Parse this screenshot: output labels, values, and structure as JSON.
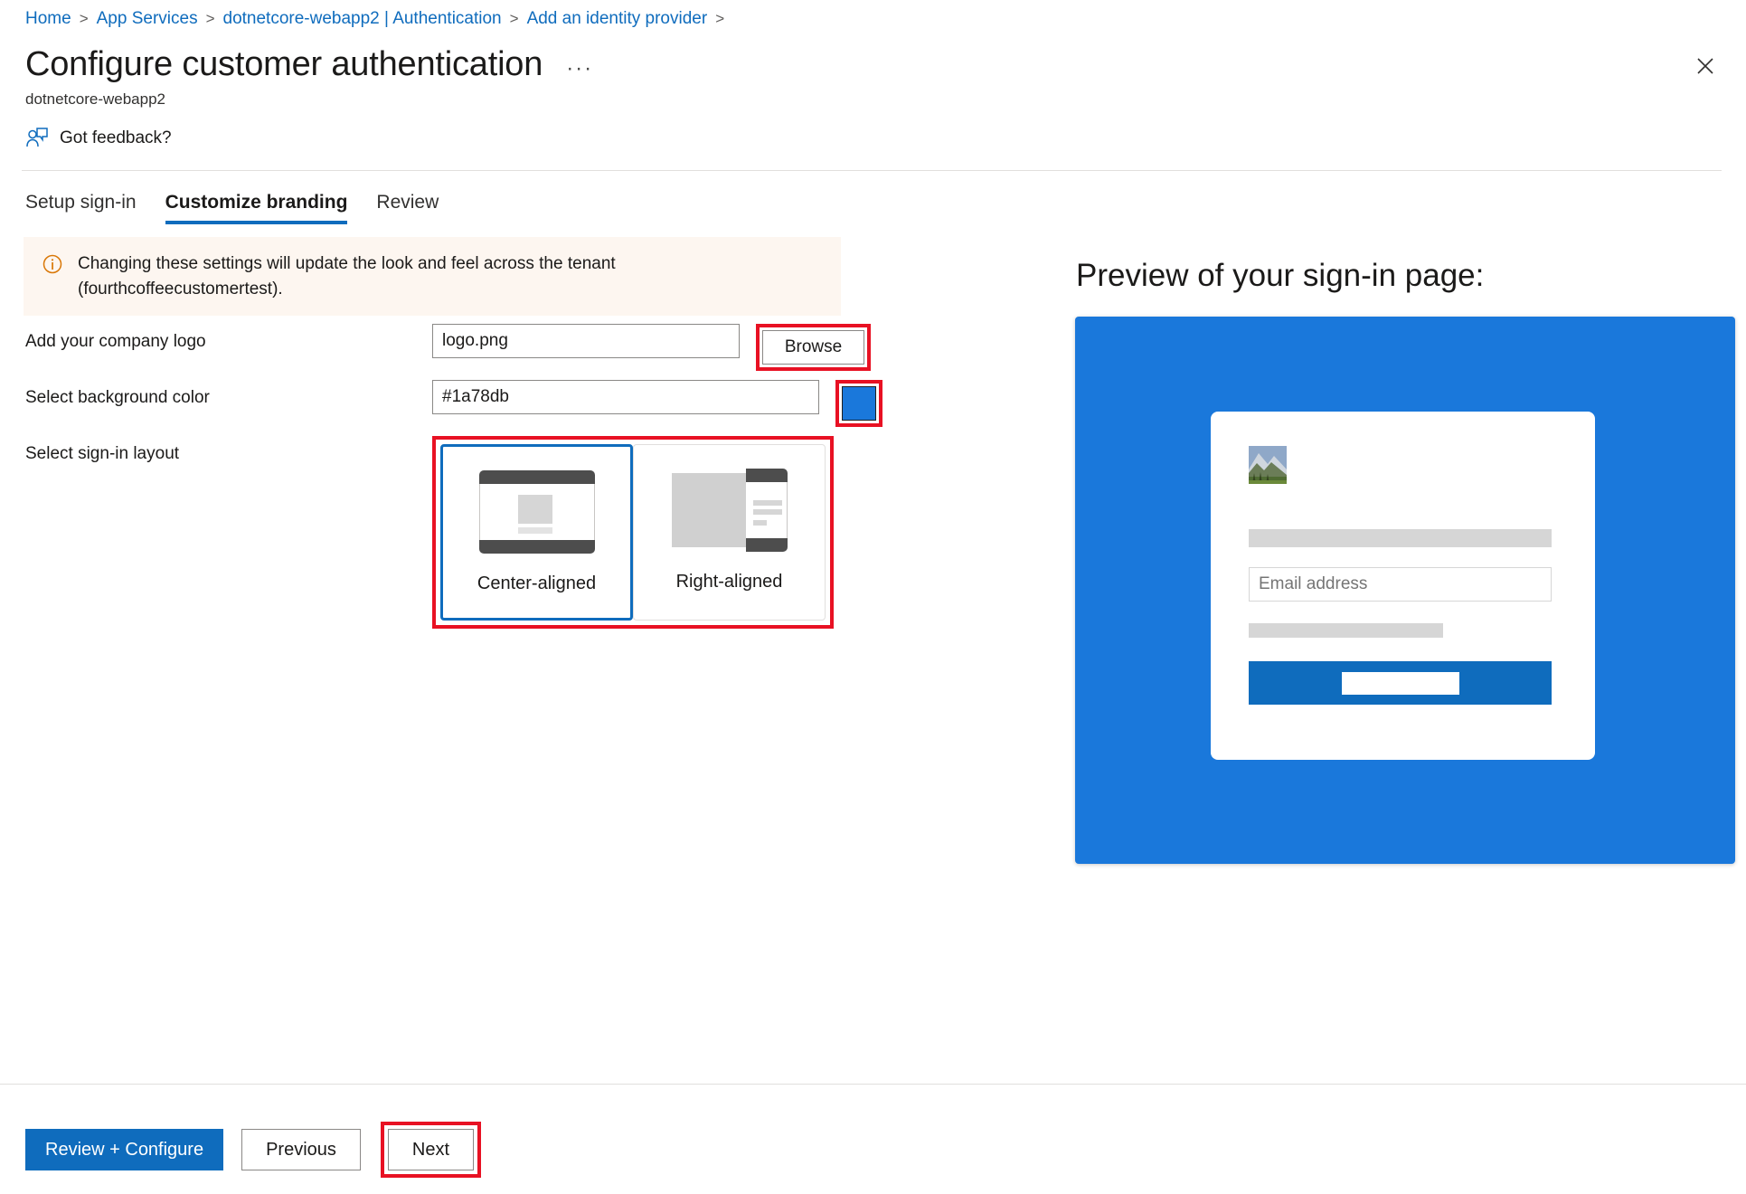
{
  "breadcrumb": {
    "items": [
      {
        "label": "Home"
      },
      {
        "label": "App Services"
      },
      {
        "label": "dotnetcore-webapp2 | Authentication"
      },
      {
        "label": "Add an identity provider"
      }
    ],
    "separator": ">"
  },
  "header": {
    "title": "Configure customer authentication",
    "ellipsis": "···",
    "subtitle": "dotnetcore-webapp2",
    "close_label": "✕"
  },
  "feedback": {
    "label": "Got feedback?"
  },
  "tabs": [
    {
      "label": "Setup sign-in",
      "active": false
    },
    {
      "label": "Customize branding",
      "active": true
    },
    {
      "label": "Review",
      "active": false
    }
  ],
  "info_banner": {
    "text": "Changing these settings will update the look and feel across the tenant (fourthcoffeecustomertest).",
    "icon": "info-icon",
    "icon_color": "#d97706",
    "background": "#fdf6f0"
  },
  "form": {
    "logo": {
      "label": "Add your company logo",
      "value": "logo.png",
      "placeholder": "",
      "browse_label": "Browse"
    },
    "background_color": {
      "label": "Select background color",
      "value": "#1a78db",
      "placeholder": "",
      "swatch_color": "#1a78db"
    },
    "layout": {
      "label": "Select sign-in layout",
      "options": [
        {
          "label": "Center-aligned",
          "selected": true
        },
        {
          "label": "Right-aligned",
          "selected": false
        }
      ]
    }
  },
  "preview": {
    "title": "Preview of your sign-in page:",
    "background_color": "#1a78db",
    "email_placeholder": "Email address",
    "submit_color": "#0f6cbd"
  },
  "footer": {
    "review_configure_label": "Review + Configure",
    "previous_label": "Previous",
    "next_label": "Next"
  },
  "annotations": {
    "highlight_color": "#e81123",
    "selected_border_color": "#0f6cbd"
  }
}
